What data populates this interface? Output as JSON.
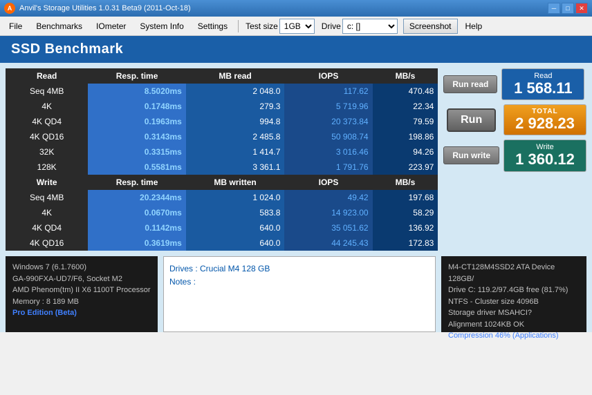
{
  "titlebar": {
    "title": "Anvil's Storage Utilities 1.0.31 Beta9 (2011-Oct-18)",
    "icon": "A"
  },
  "menubar": {
    "file": "File",
    "benchmarks": "Benchmarks",
    "iometer": "IOmeter",
    "system_info": "System Info",
    "settings": "Settings",
    "test_size_label": "Test size",
    "test_size_value": "1GB",
    "drive_label": "Drive",
    "drive_value": "c: []",
    "screenshot": "Screenshot",
    "help": "Help"
  },
  "page_title": "SSD Benchmark",
  "table": {
    "headers": [
      "Read",
      "Resp. time",
      "MB read",
      "IOPS",
      "MB/s"
    ],
    "read_rows": [
      {
        "label": "Seq 4MB",
        "resp": "8.5020ms",
        "mb": "2 048.0",
        "iops": "117.62",
        "mbs": "470.48"
      },
      {
        "label": "4K",
        "resp": "0.1748ms",
        "mb": "279.3",
        "iops": "5 719.96",
        "mbs": "22.34"
      },
      {
        "label": "4K QD4",
        "resp": "0.1963ms",
        "mb": "994.8",
        "iops": "20 373.84",
        "mbs": "79.59"
      },
      {
        "label": "4K QD16",
        "resp": "0.3143ms",
        "mb": "2 485.8",
        "iops": "50 908.74",
        "mbs": "198.86"
      },
      {
        "label": "32K",
        "resp": "0.3315ms",
        "mb": "1 414.7",
        "iops": "3 016.46",
        "mbs": "94.26"
      },
      {
        "label": "128K",
        "resp": "0.5581ms",
        "mb": "3 361.1",
        "iops": "1 791.76",
        "mbs": "223.97"
      }
    ],
    "write_headers": [
      "Write",
      "Resp. time",
      "MB written",
      "IOPS",
      "MB/s"
    ],
    "write_rows": [
      {
        "label": "Seq 4MB",
        "resp": "20.2344ms",
        "mb": "1 024.0",
        "iops": "49.42",
        "mbs": "197.68"
      },
      {
        "label": "4K",
        "resp": "0.0670ms",
        "mb": "583.8",
        "iops": "14 923.00",
        "mbs": "58.29"
      },
      {
        "label": "4K QD4",
        "resp": "0.1142ms",
        "mb": "640.0",
        "iops": "35 051.62",
        "mbs": "136.92"
      },
      {
        "label": "4K QD16",
        "resp": "0.3619ms",
        "mb": "640.0",
        "iops": "44 245.43",
        "mbs": "172.83"
      }
    ]
  },
  "scores": {
    "read_label": "Read",
    "read_value": "1 568.11",
    "total_label": "TOTAL",
    "total_value": "2 928.23",
    "write_label": "Write",
    "write_value": "1 360.12"
  },
  "buttons": {
    "run_read": "Run read",
    "run": "Run",
    "run_write": "Run write"
  },
  "system": {
    "os": "Windows 7 (6.1.7600)",
    "board": "GA-990FXA-UD7/F6, Socket M2",
    "cpu": "AMD Phenom(tm) II X6 1100T Processor",
    "memory": "Memory : 8 189 MB",
    "edition": "Pro Edition (Beta)"
  },
  "notes": {
    "drives": "Drives : Crucial M4 128 GB",
    "notes": "Notes :"
  },
  "drive_info": {
    "model": "M4-CT128M4SSD2 ATA Device 128GB/",
    "drive_c": "Drive C: 119.2/97.4GB free (81.7%)",
    "ntfs": "NTFS - Cluster size 4096B",
    "storage": "Storage driver  MSAHCI?",
    "alignment": "Alignment 1024KB OK",
    "compression": "Compression 46% (Applications)"
  }
}
